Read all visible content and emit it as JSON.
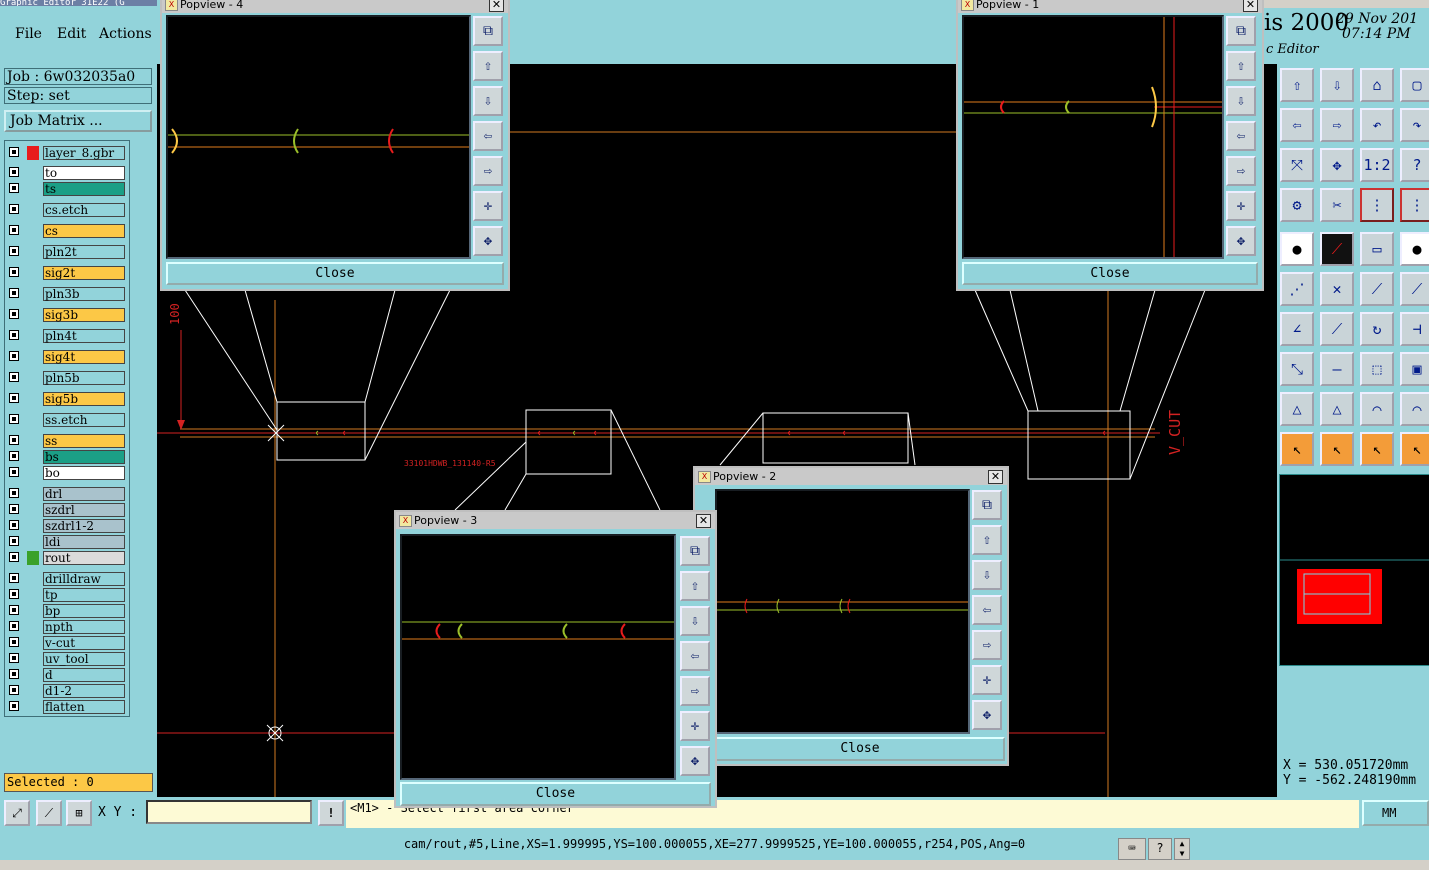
{
  "window": {
    "title": "Graphic Editor 31E22 (G"
  },
  "menu": {
    "file": "File",
    "edit": "Edit",
    "actions": "Actions"
  },
  "job": {
    "job_label": "Job : 6w032035a0",
    "step_label": "Step: set",
    "matrix_button": "Job Matrix ..."
  },
  "layers": [
    {
      "name": "layer_8.gbr",
      "color": "#92d3da"
    },
    {
      "name": "to",
      "color": "#ffffff"
    },
    {
      "name": "ts",
      "color": "#1b9f86"
    },
    {
      "name": "cs.etch",
      "color": "#92d3da"
    },
    {
      "name": "cs",
      "color": "#fcc846"
    },
    {
      "name": "pln2t",
      "color": "#92d3da"
    },
    {
      "name": "sig2t",
      "color": "#fcc846"
    },
    {
      "name": "pln3b",
      "color": "#92d3da"
    },
    {
      "name": "sig3b",
      "color": "#fcc846"
    },
    {
      "name": "pln4t",
      "color": "#92d3da"
    },
    {
      "name": "sig4t",
      "color": "#fcc846"
    },
    {
      "name": "pln5b",
      "color": "#92d3da"
    },
    {
      "name": "sig5b",
      "color": "#fcc846"
    },
    {
      "name": "ss.etch",
      "color": "#92d3da"
    },
    {
      "name": "ss",
      "color": "#fcc846"
    },
    {
      "name": "bs",
      "color": "#1b9f86"
    },
    {
      "name": "bo",
      "color": "#ffffff"
    },
    {
      "name": "drl",
      "color": "#a9c2cc"
    },
    {
      "name": "szdrl",
      "color": "#a9c2cc"
    },
    {
      "name": "szdrl1-2",
      "color": "#a9c2cc"
    },
    {
      "name": "ldi",
      "color": "#a9c2cc"
    },
    {
      "name": "rout",
      "color": "#dbdbdb"
    },
    {
      "name": "drilldraw",
      "color": "#92d3da"
    },
    {
      "name": "tp",
      "color": "#92d3da"
    },
    {
      "name": "bp",
      "color": "#92d3da"
    },
    {
      "name": "npth",
      "color": "#92d3da"
    },
    {
      "name": "v-cut",
      "color": "#92d3da"
    },
    {
      "name": "uv_tool",
      "color": "#92d3da"
    },
    {
      "name": "d",
      "color": "#92d3da"
    },
    {
      "name": "d1-2",
      "color": "#92d3da"
    },
    {
      "name": "flatten",
      "color": "#92d3da"
    }
  ],
  "selected": "Selected : 0",
  "header": {
    "app_title": "is 2000",
    "date_line1": "29 Nov 201",
    "date_line2": "07:14 PM",
    "subtitle": "c Editor"
  },
  "coords": {
    "x": "X = 530.051720mm",
    "y": "Y = -562.248190mm"
  },
  "cmd": {
    "xy_label": "X Y :",
    "xy_value": "",
    "message": "<M1> - Select first area corner",
    "units": "MM"
  },
  "status": "cam/rout,#5,Line,XS=1.999995,YS=100.000055,XE=277.9999525,YE=100.000055,r254,POS,Ang=0",
  "canvas": {
    "dimension_label": "100",
    "vcut_label": "V_CUT",
    "part_label": "33101HDWB_131140-R5"
  },
  "popups": {
    "p4": {
      "title": "Popview - 4",
      "close": "Close"
    },
    "p1": {
      "title": "Popview - 1",
      "close": "Close"
    },
    "p2": {
      "title": "Popview - 2",
      "close": "Close"
    },
    "p3": {
      "title": "Popview - 3",
      "close": "Close"
    }
  },
  "colors": {
    "panel": "#92d3da",
    "trace_orange": "#e07b1c",
    "trace_green": "#9bbf2a",
    "trace_red": "#e81c1c",
    "accent_yellow": "#fcc846"
  }
}
